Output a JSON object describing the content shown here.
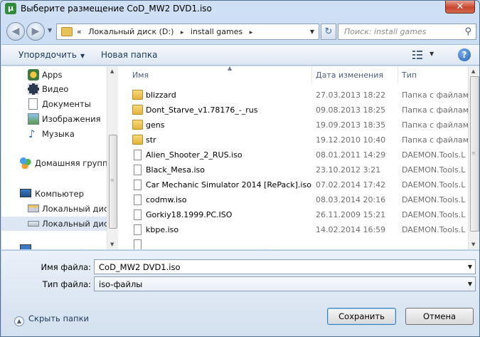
{
  "window": {
    "title": "Выберите размещение CoD_MW2 DVD1.iso",
    "app_icon_glyph": "µ",
    "close_glyph": "✕"
  },
  "nav": {
    "back_glyph": "◀",
    "forward_glyph": "▶",
    "refresh_glyph": "↻",
    "breadcrumb_prefix": "«",
    "breadcrumb": [
      "Локальный диск (D:)",
      "install games"
    ],
    "breadcrumb_sep": "▸",
    "search_placeholder": "Поиск: install games"
  },
  "toolbar": {
    "organize_label": "Упорядочить",
    "new_folder_label": "Новая папка",
    "help_glyph": "?"
  },
  "sidebar": {
    "items": [
      {
        "label": "Apps",
        "icon": "apps-icon"
      },
      {
        "label": "Видео",
        "icon": "video-icon"
      },
      {
        "label": "Документы",
        "icon": "documents-icon"
      },
      {
        "label": "Изображения",
        "icon": "images-icon"
      },
      {
        "label": "Музыка",
        "icon": "music-icon"
      },
      {
        "label": "Домашняя группа",
        "icon": "homegroup-icon"
      },
      {
        "label": "Компьютер",
        "icon": "computer-icon"
      },
      {
        "label": "Локальный диск",
        "icon": "drive-icon"
      },
      {
        "label": "Локальный диск",
        "icon": "drive-icon"
      }
    ]
  },
  "files": {
    "columns": {
      "name": "Имя",
      "date": "Дата изменения",
      "type": "Тип"
    },
    "sort_glyph": "▲",
    "rows": [
      {
        "name": "blizzard",
        "date": "27.03.2013 18:22",
        "type": "Папка с файлами",
        "kind": "folder"
      },
      {
        "name": "Dont_Starve_v1.78176_-_rus",
        "date": "09.08.2013 18:25",
        "type": "Папка с файлами",
        "kind": "folder"
      },
      {
        "name": "gens",
        "date": "19.09.2013 18:35",
        "type": "Папка с файлами",
        "kind": "folder"
      },
      {
        "name": "str",
        "date": "19.12.2010 10:40",
        "type": "Папка с файлами",
        "kind": "folder"
      },
      {
        "name": "Alien_Shooter_2_RUS.iso",
        "date": "08.01.2011 14:29",
        "type": "DAEMON.Tools.L",
        "kind": "file"
      },
      {
        "name": "Black_Mesa.iso",
        "date": "23.10.2012 3:21",
        "type": "DAEMON.Tools.L",
        "kind": "file"
      },
      {
        "name": "Car Mechanic Simulator 2014 [RePack].iso",
        "date": "07.02.2014 17:42",
        "type": "DAEMON.Tools.L",
        "kind": "file"
      },
      {
        "name": "codmw.iso",
        "date": "08.03.2014 20:16",
        "type": "DAEMON.Tools.L",
        "kind": "file"
      },
      {
        "name": "Gorkiy18.1999.PC.ISO",
        "date": "26.11.2009 15:21",
        "type": "DAEMON.Tools.L",
        "kind": "file"
      },
      {
        "name": "kbpe.iso",
        "date": "14.02.2014 16:59",
        "type": "DAEMON.Tools.L",
        "kind": "file"
      }
    ]
  },
  "form": {
    "filename_label": "Имя файла:",
    "filename_value": "CoD_MW2 DVD1.iso",
    "filetype_label": "Тип файла:",
    "filetype_value": "iso-файлы",
    "hide_folders_label": "Скрыть папки",
    "save_label": "Сохранить",
    "cancel_label": "Отмена"
  },
  "colors": {
    "accent": "#3c7fb1",
    "folder": "#e3b43e",
    "title_bar": "#b9d1ee"
  }
}
